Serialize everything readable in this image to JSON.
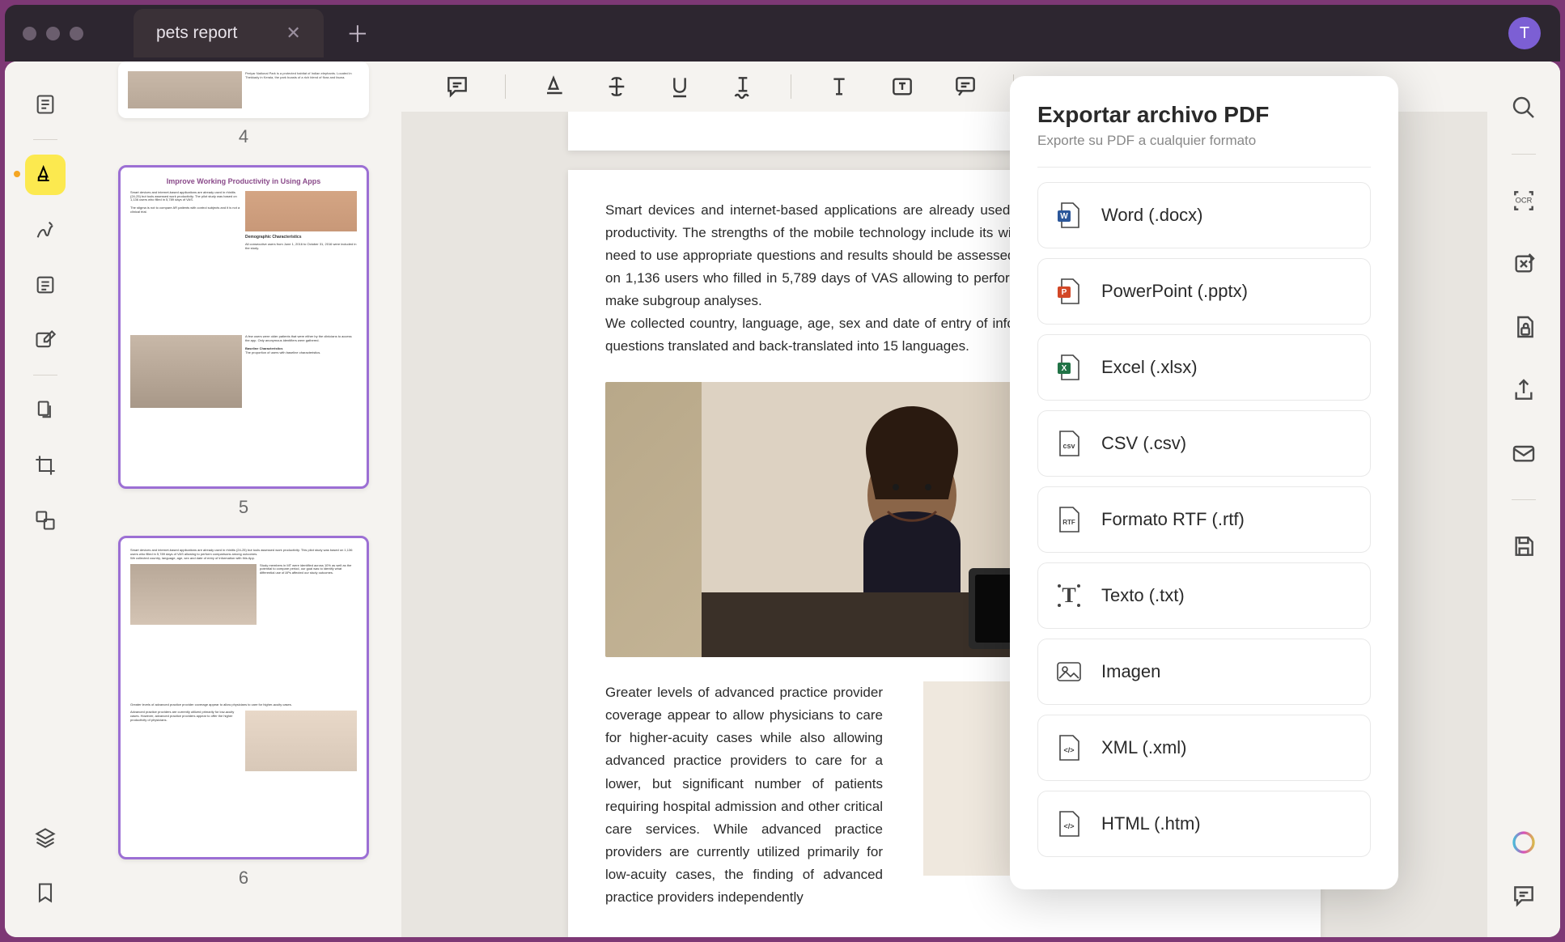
{
  "tab": {
    "title": "pets report",
    "avatar_initial": "T"
  },
  "thumbnails": {
    "page4": "4",
    "page5": "5",
    "page5_title": "Improve Working Productivity in Using Apps",
    "page6": "6"
  },
  "document": {
    "para1": "Smart devices and internet-based applications are already used in rhinitis (24-25) but tools assessed work productivity. The strengths of the mobile technology include its wide acceptance and easy use, but there is a need to use appropriate questions and results should be assessed by pilot studies. This pilot study was based on 1,136 users who filled in 5,789 days of VAS allowing to perform comparisons among outcomes, but not to make subgroup analyses.",
    "para2": "We collected country, language, age, sex and date of entry of information with this App. We used very simple questions translated and back-translated into 15 languages.",
    "para3": "Greater levels of advanced practice provider coverage appear to allow physicians to care for higher-acuity cases while also allowing advanced practice providers to care for a lower, but significant number of patients requiring hospital admission and other critical care services. While advanced practice providers are currently utilized primarily for low-acuity cases, the finding of advanced practice providers independently"
  },
  "export": {
    "title": "Exportar archivo PDF",
    "subtitle": "Exporte su PDF a cualquier formato",
    "items": [
      {
        "label": "Word (.docx)"
      },
      {
        "label": "PowerPoint (.pptx)"
      },
      {
        "label": "Excel (.xlsx)"
      },
      {
        "label": "CSV (.csv)"
      },
      {
        "label": "Formato RTF (.rtf)"
      },
      {
        "label": "Texto (.txt)"
      },
      {
        "label": "Imagen"
      },
      {
        "label": "XML (.xml)"
      },
      {
        "label": "HTML (.htm)"
      }
    ]
  },
  "icons": {
    "word_letter": "W",
    "ppt_letter": "P",
    "xls_letter": "X",
    "csv_letter": "csv",
    "rtf_letter": "RTF",
    "txt_letter": "T",
    "xml_letter": "</>",
    "html_letter": "</>"
  }
}
